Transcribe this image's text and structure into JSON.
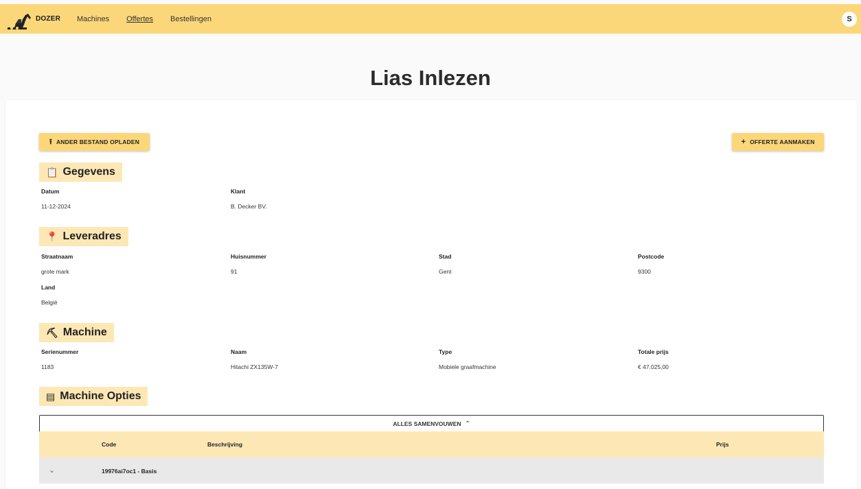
{
  "header": {
    "logo_text": "DOZER",
    "nav": [
      {
        "label": "Machines",
        "active": false
      },
      {
        "label": "Offertes",
        "active": true
      },
      {
        "label": "Bestellingen",
        "active": false
      }
    ],
    "avatar_initial": "S",
    "colors": {
      "accent": "#fcd779",
      "chip": "#fde8b5"
    }
  },
  "page": {
    "title": "Lias Inlezen"
  },
  "actions": {
    "upload_label": "ANDER BESTAND OPLADEN",
    "upload_icon": "upload-icon",
    "create_label": "OFFERTE AANMAKEN",
    "create_icon": "plus-icon"
  },
  "gegevens": {
    "title": "Gegevens",
    "icon": "clipboard-icon",
    "fields": [
      {
        "label": "Datum",
        "value": "11-12-2024"
      },
      {
        "label": "Klant",
        "value": "B. Decker BV."
      }
    ]
  },
  "leveradres": {
    "title": "Leveradres",
    "icon": "location-pin-icon",
    "fields": [
      {
        "label": "Straatnaam",
        "value": "grote mark"
      },
      {
        "label": "Huisnummer",
        "value": "91"
      },
      {
        "label": "Stad",
        "value": "Gent"
      },
      {
        "label": "Postcode",
        "value": "9300"
      },
      {
        "label": "Land",
        "value": "België"
      }
    ]
  },
  "machine": {
    "title": "Machine",
    "icon": "excavator-icon",
    "fields": [
      {
        "label": "Serienummer",
        "value": "1183"
      },
      {
        "label": "Naam",
        "value": "Hitachi ZX135W-7"
      },
      {
        "label": "Type",
        "value": "Mobiele graafmachine"
      },
      {
        "label": "Totale prijs",
        "value": "€ 47.025,00"
      }
    ]
  },
  "opties": {
    "title": "Machine Opties",
    "icon": "list-icon",
    "collapse_label": "ALLES SAMENVOUWEN",
    "columns": [
      "Code",
      "Beschrijving",
      "Prijs"
    ],
    "rows": [
      {
        "code": "19976ai7oc1 - Basis"
      }
    ]
  }
}
